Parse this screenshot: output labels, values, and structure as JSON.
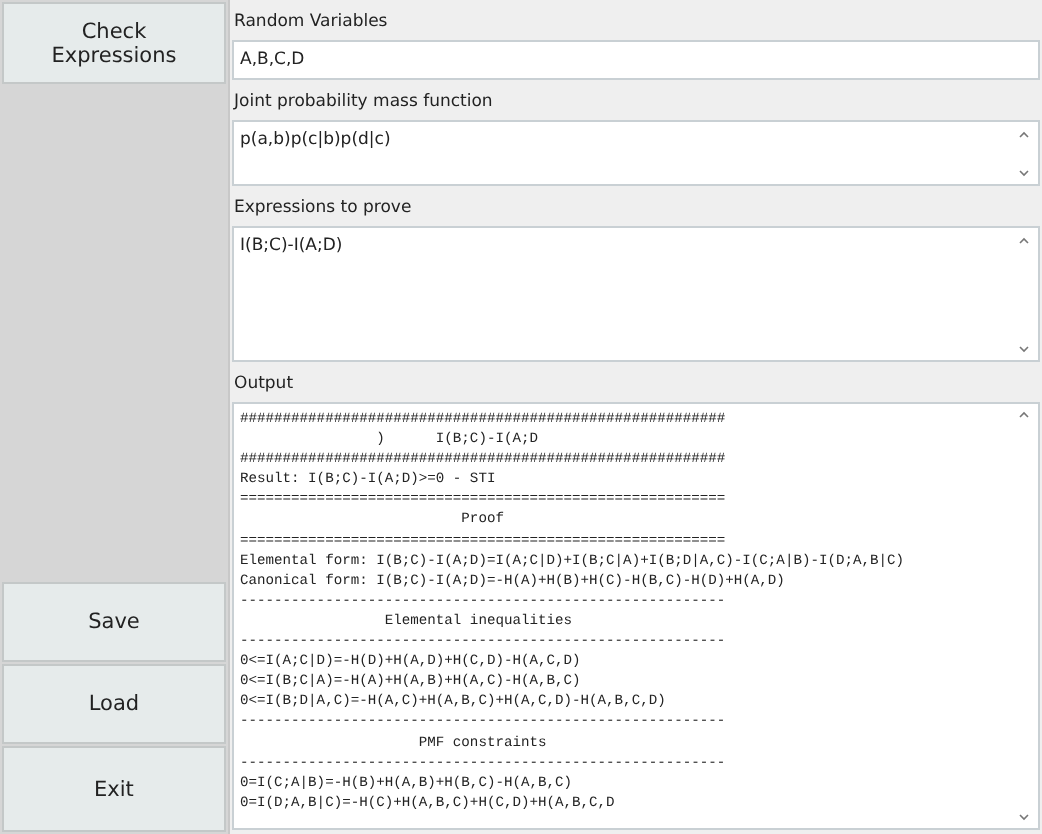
{
  "sidebar": {
    "top_button": "Check Expressions",
    "bottom_buttons": [
      "Save",
      "Load",
      "Exit"
    ]
  },
  "fields": [
    {
      "label": "Random Variables",
      "kind": "line",
      "value": "A,B,C,D"
    },
    {
      "label": "Joint probability mass function",
      "kind": "area",
      "value": "p(a,b)p(c|b)p(d|c)"
    },
    {
      "label": "Expressions to prove",
      "kind": "area",
      "value": "I(B;C)-I(A;D)"
    }
  ],
  "output": {
    "label": "Output",
    "lines": [
      "#########################################################",
      "                )      I(B;C)-I(A;D",
      "#########################################################",
      "Result: I(B;C)-I(A;D)>=0 - STI",
      "=========================================================",
      "                          Proof",
      "=========================================================",
      "Elemental form: I(B;C)-I(A;D)=I(A;C|D)+I(B;C|A)+I(B;D|A,C)-I(C;A|B)-I(D;A,B|C)",
      "Canonical form: I(B;C)-I(A;D)=-H(A)+H(B)+H(C)-H(B,C)-H(D)+H(A,D)",
      "---------------------------------------------------------",
      "                 Elemental inequalities",
      "---------------------------------------------------------",
      "0<=I(A;C|D)=-H(D)+H(A,D)+H(C,D)-H(A,C,D)",
      "0<=I(B;C|A)=-H(A)+H(A,B)+H(A,C)-H(A,B,C)",
      "0<=I(B;D|A,C)=-H(A,C)+H(A,B,C)+H(A,C,D)-H(A,B,C,D)",
      "---------------------------------------------------------",
      "                     PMF constraints",
      "---------------------------------------------------------",
      "0=I(C;A|B)=-H(B)+H(A,B)+H(B,C)-H(A,B,C)",
      "0=I(D;A,B|C)=-H(C)+H(A,B,C)+H(C,D)+H(A,B,C,D"
    ]
  }
}
